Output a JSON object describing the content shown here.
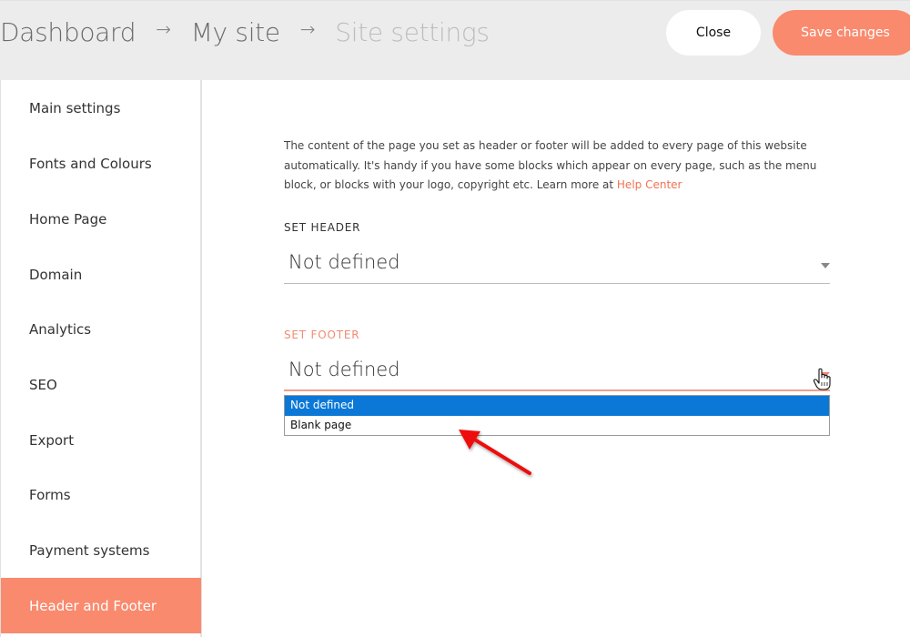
{
  "breadcrumb": {
    "items": [
      "Dashboard",
      "My site",
      "Site settings"
    ],
    "separator": "→"
  },
  "toolbar": {
    "close_label": "Close",
    "save_label": "Save changes"
  },
  "colors": {
    "accent": "#f98a6e",
    "link": "#f07355",
    "selected_option": "#0b78d7"
  },
  "sidebar": {
    "items": [
      {
        "label": "Main settings"
      },
      {
        "label": "Fonts and Colours"
      },
      {
        "label": "Home Page"
      },
      {
        "label": "Domain"
      },
      {
        "label": "Analytics"
      },
      {
        "label": "SEO"
      },
      {
        "label": "Export"
      },
      {
        "label": "Forms"
      },
      {
        "label": "Payment systems"
      },
      {
        "label": "Header and Footer",
        "active": true
      }
    ]
  },
  "main": {
    "description": "The content of the page you set as header or footer will be added to every page of this website automatically. It's handy if you have some blocks which appear on every page, such as the menu block, or blocks with your logo, copyright etc. Learn more at ",
    "help_link": "Help Center",
    "header_select": {
      "label": "SET HEADER",
      "value": "Not defined"
    },
    "footer_select": {
      "label": "SET FOOTER",
      "value": "Not defined",
      "open": true,
      "options": [
        "Not defined",
        "Blank page"
      ],
      "highlighted": "Not defined"
    }
  },
  "annotation": {
    "icon": "red-arrow-icon",
    "points_to": "Blank page"
  }
}
